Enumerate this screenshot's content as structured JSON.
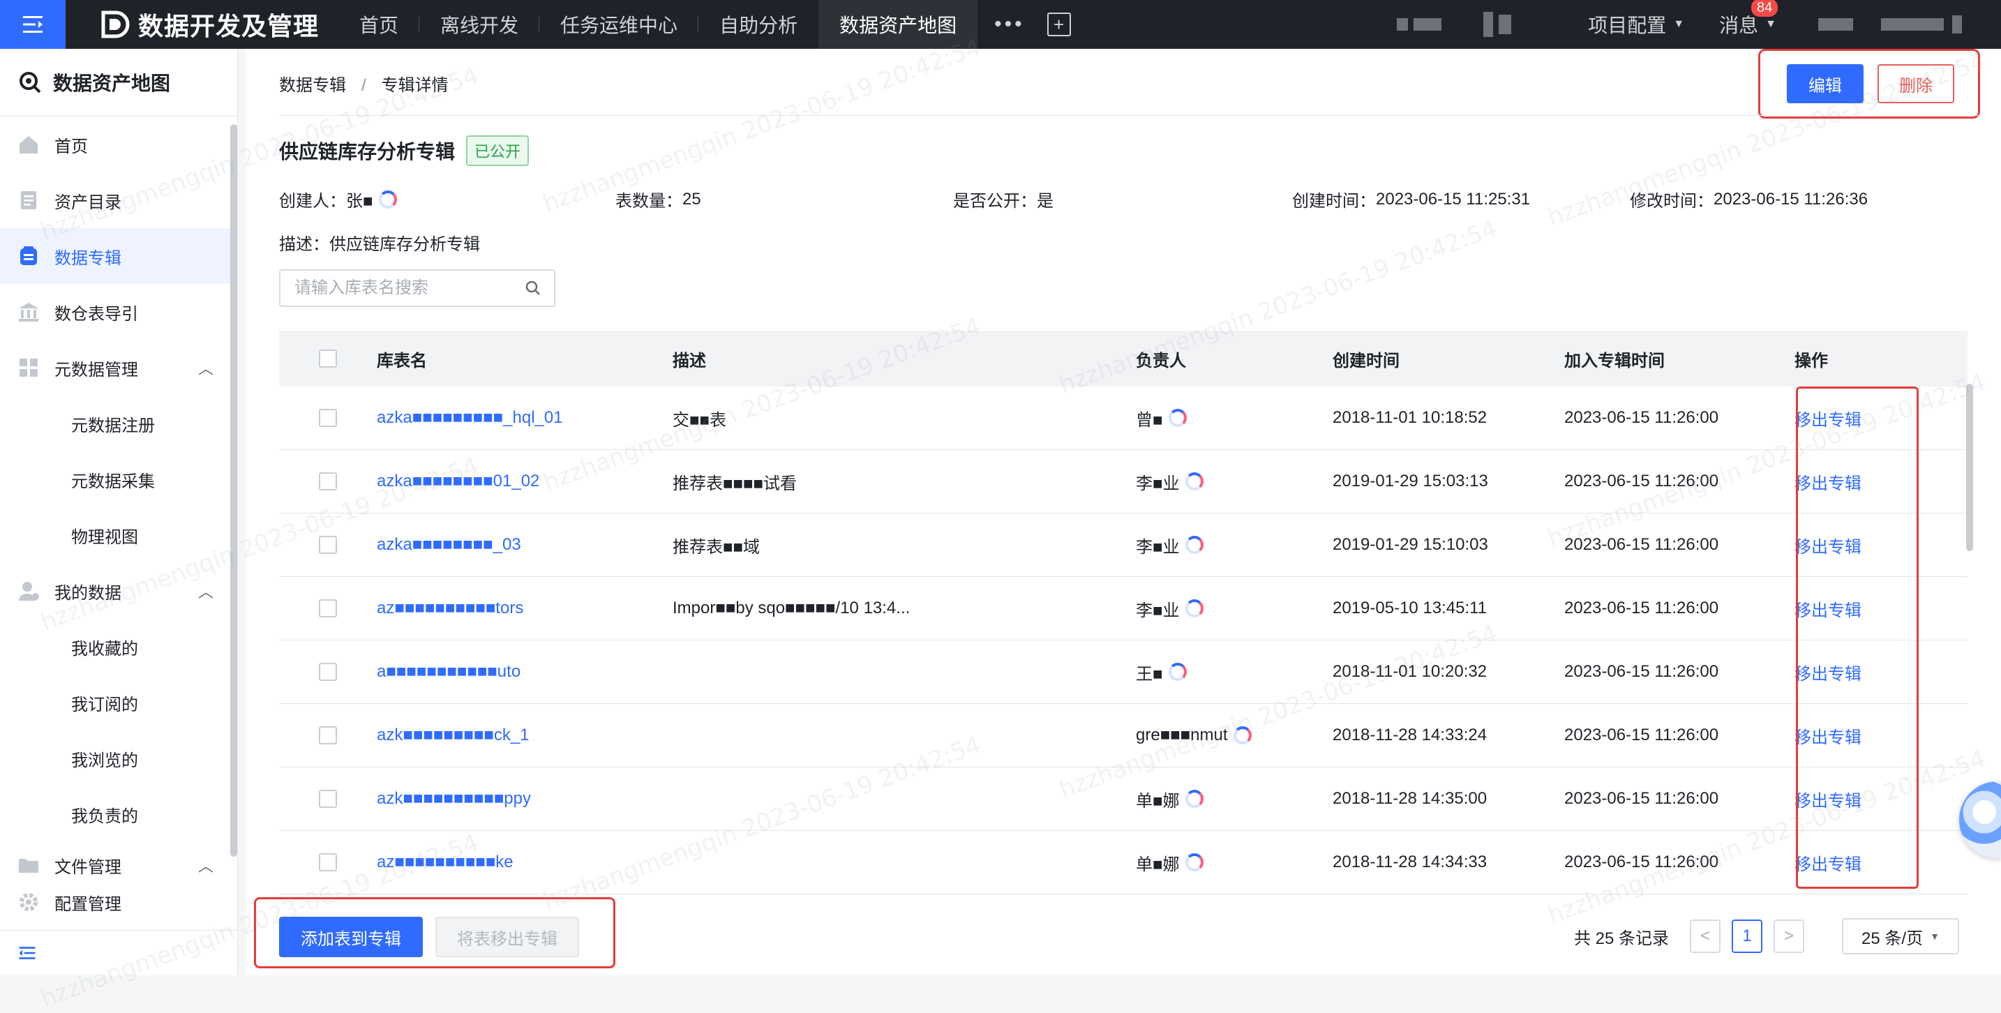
{
  "topnav": {
    "brand": "数据开发及管理",
    "items": [
      {
        "label": "首页"
      },
      {
        "label": "离线开发"
      },
      {
        "label": "任务运维中心"
      },
      {
        "label": "自助分析"
      },
      {
        "label": "数据资产地图",
        "active": true
      }
    ],
    "more": "•••",
    "add": "+",
    "project_config": "项目配置",
    "messages": "消息",
    "message_badge": "84"
  },
  "sidebar": {
    "header": "数据资产地图",
    "items": [
      {
        "label": "首页",
        "icon": "home-icon"
      },
      {
        "label": "资产目录",
        "icon": "catalog-icon"
      },
      {
        "label": "数据专辑",
        "icon": "album-icon",
        "active": true
      },
      {
        "label": "数仓表导引",
        "icon": "bank-icon"
      },
      {
        "label": "元数据管理",
        "icon": "grid-icon",
        "expanded": true,
        "children": [
          "元数据注册",
          "元数据采集",
          "物理视图"
        ]
      },
      {
        "label": "我的数据",
        "icon": "user-icon",
        "expanded": true,
        "children": [
          "我收藏的",
          "我订阅的",
          "我浏览的",
          "我负责的"
        ]
      },
      {
        "label": "文件管理",
        "icon": "folder-icon",
        "expanded": true
      },
      {
        "label": "配置管理",
        "icon": "gear-icon"
      }
    ]
  },
  "breadcrumb": {
    "parent": "数据专辑",
    "separator": "/",
    "current": "专辑详情"
  },
  "actions": {
    "edit": "编辑",
    "delete": "删除"
  },
  "album": {
    "title": "供应链库存分析专辑",
    "status_tag": "已公开",
    "creator_label": "创建人：",
    "creator": "张■",
    "table_count_label": "表数量：",
    "table_count": "25",
    "public_label": "是否公开：",
    "public_value": "是",
    "created_label": "创建时间：",
    "created": "2023-06-15 11:25:31",
    "modified_label": "修改时间：",
    "modified": "2023-06-15 11:26:36",
    "desc_label": "描述：",
    "desc": "供应链库存分析专辑"
  },
  "search": {
    "placeholder": "请输入库表名搜索"
  },
  "table": {
    "columns": [
      "库表名",
      "描述",
      "负责人",
      "创建时间",
      "加入专辑时间",
      "操作"
    ],
    "rows": [
      {
        "name": "azka■■■■■■■■■_hql_01",
        "desc": "交■■表",
        "owner": "曾■",
        "created": "2018-11-01 10:18:52",
        "joined": "2023-06-15 11:26:00",
        "op": "移出专辑"
      },
      {
        "name": "azka■■■■■■■■01_02",
        "desc": "推荐表■■■■试看",
        "owner": "李■业",
        "created": "2019-01-29 15:03:13",
        "joined": "2023-06-15 11:26:00",
        "op": "移出专辑"
      },
      {
        "name": "azka■■■■■■■■_03",
        "desc": "推荐表■■域",
        "owner": "李■业",
        "created": "2019-01-29 15:10:03",
        "joined": "2023-06-15 11:26:00",
        "op": "移出专辑"
      },
      {
        "name": "az■■■■■■■■■■tors",
        "desc": "Impor■■by sqo■■■■■/10 13:4...",
        "owner": "李■业",
        "created": "2019-05-10 13:45:11",
        "joined": "2023-06-15 11:26:00",
        "op": "移出专辑"
      },
      {
        "name": "a■■■■■■■■■■■uto",
        "desc": "",
        "owner": "王■",
        "created": "2018-11-01 10:20:32",
        "joined": "2023-06-15 11:26:00",
        "op": "移出专辑"
      },
      {
        "name": "azk■■■■■■■■■ck_1",
        "desc": "",
        "owner": "gre■■■nmut",
        "created": "2018-11-28 14:33:24",
        "joined": "2023-06-15 11:26:00",
        "op": "移出专辑"
      },
      {
        "name": "azk■■■■■■■■■■ppy",
        "desc": "",
        "owner": "单■娜",
        "created": "2018-11-28 14:35:00",
        "joined": "2023-06-15 11:26:00",
        "op": "移出专辑"
      },
      {
        "name": "az■■■■■■■■■■ke",
        "desc": "",
        "owner": "单■娜",
        "created": "2018-11-28 14:34:33",
        "joined": "2023-06-15 11:26:00",
        "op": "移出专辑"
      }
    ]
  },
  "footer": {
    "add_button": "添加表到专辑",
    "remove_button": "将表移出专辑",
    "total": "共 25 条记录",
    "prev": "<",
    "page": "1",
    "next": ">",
    "page_size": "25 条/页"
  },
  "watermark": "hzzhangmengqin 2023-06-19 20:42:54"
}
